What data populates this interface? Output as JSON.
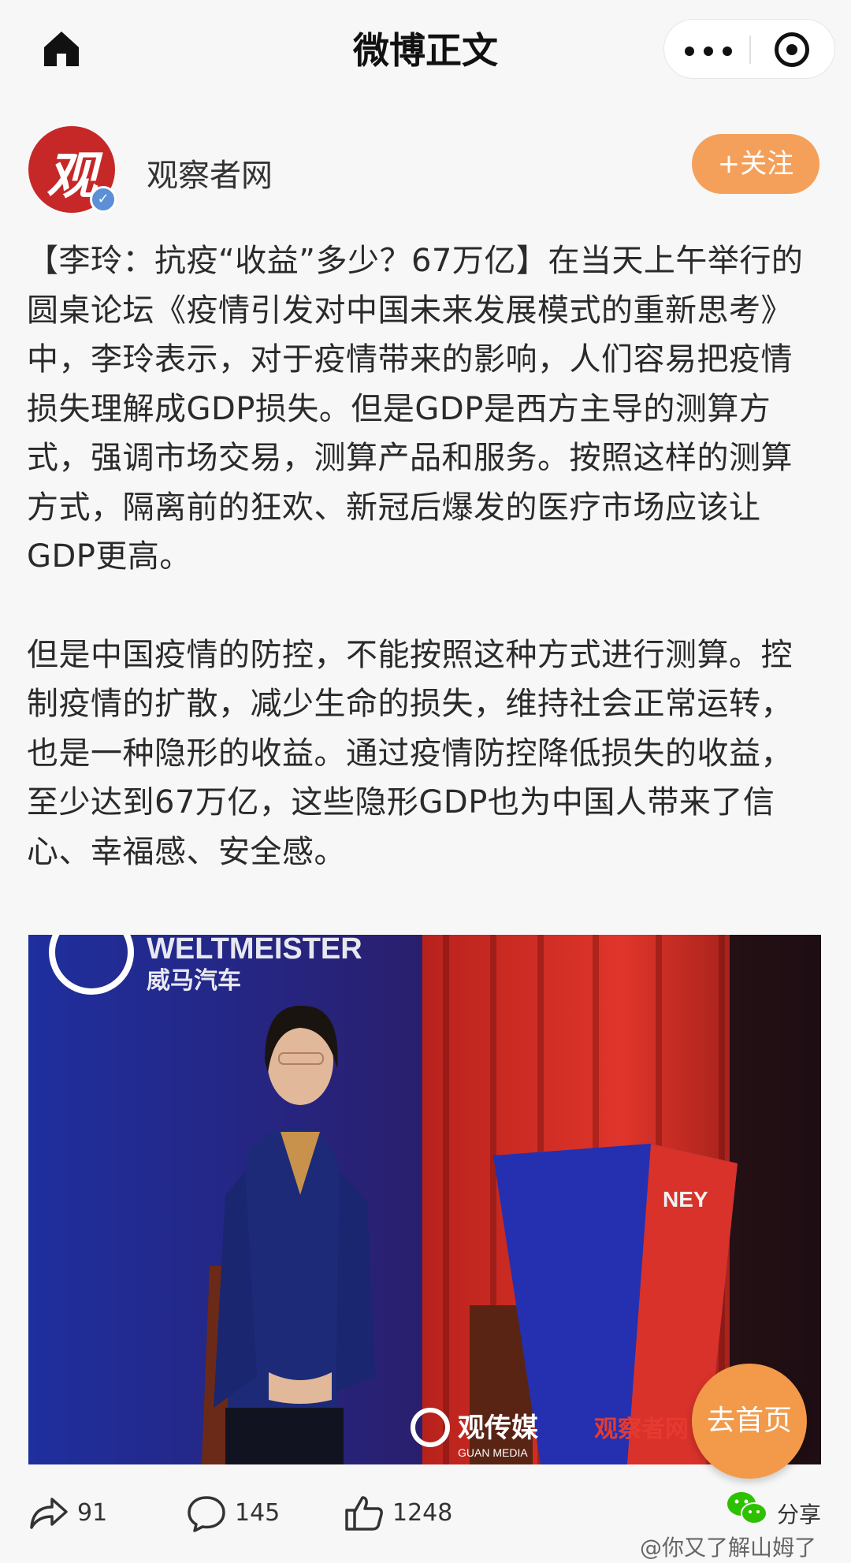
{
  "nav": {
    "title": "微博正文"
  },
  "author": {
    "name": "观察者网",
    "avatar_char": "观",
    "verified_mark": "✓",
    "follow_label": "+关注"
  },
  "post": {
    "paragraph1": "【李玲：抗疫“收益”多少？67万亿】在当天上午举行的圆桌论坛《疫情引发对中国未来发展模式的重新思考》中，李玲表示，对于疫情带来的影响，人们容易把疫情损失理解成GDP损失。但是GDP是西方主导的测算方式，强调市场交易，测算产品和服务。按照这样的测算方式，隔离前的狂欢、新冠后爆发的医疗市场应该让GDP更高。",
    "paragraph2": "但是中国疫情的防控，不能按照这种方式进行测算。控制疫情的扩散，减少生命的损失，维持社会正常运转，也是一种隐形的收益。通过疫情防控降低损失的收益，至少达到67万亿，这些隐形GDP也为中国人带来了信心、幸福感、安全感。"
  },
  "photo": {
    "sponsor_text": "WELTMEISTER",
    "sponsor_cn": "威马汽车",
    "podium_text": "NEY",
    "credit1": "观传媒",
    "credit1_sub": "GUAN MEDIA",
    "credit2": "观察者网"
  },
  "floating": {
    "home_label": "去首页"
  },
  "actions": {
    "repost_count": "91",
    "comment_count": "145",
    "like_count": "1248",
    "share_label": "分享"
  },
  "watermark": "@你又了解山姆了",
  "colors": {
    "accent_orange": "#f29a4a",
    "avatar_red": "#c62828"
  }
}
